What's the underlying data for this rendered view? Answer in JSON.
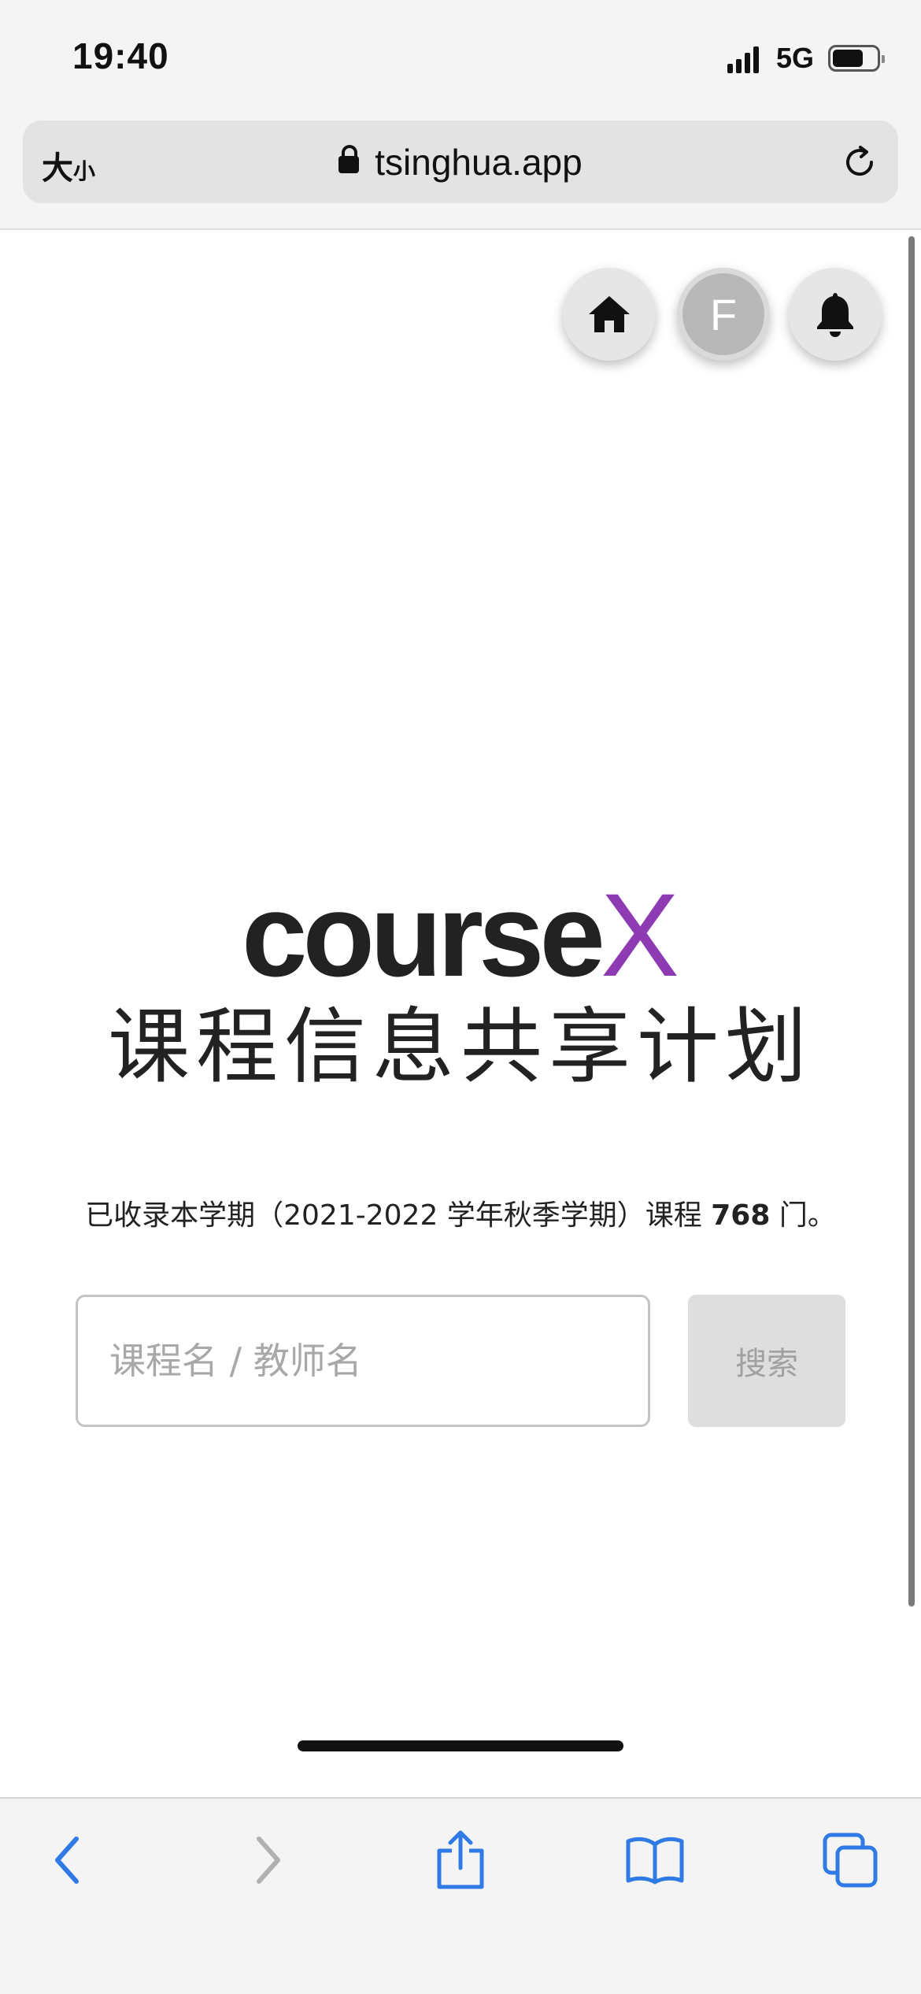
{
  "status_bar": {
    "time": "19:40",
    "network": "5G"
  },
  "browser": {
    "text_size_label_big": "大",
    "text_size_label_small": "小",
    "url": "tsinghua.app"
  },
  "header_buttons": {
    "avatar_letter": "F"
  },
  "hero": {
    "logo_main": "course",
    "logo_accent": "X",
    "subtitle": "课程信息共享计划"
  },
  "summary": {
    "prefix": "已收录本学期（2021-2022 学年秋季学期）课程 ",
    "count": "768",
    "suffix": " 门。"
  },
  "search": {
    "placeholder": "课程名 / 教师名",
    "button_label": "搜索"
  },
  "colors": {
    "accent": "#8e3bb3",
    "safari_blue": "#2f7ae5"
  },
  "toolbar_icons": [
    "back-icon",
    "forward-icon",
    "share-icon",
    "bookmarks-icon",
    "tabs-icon"
  ]
}
